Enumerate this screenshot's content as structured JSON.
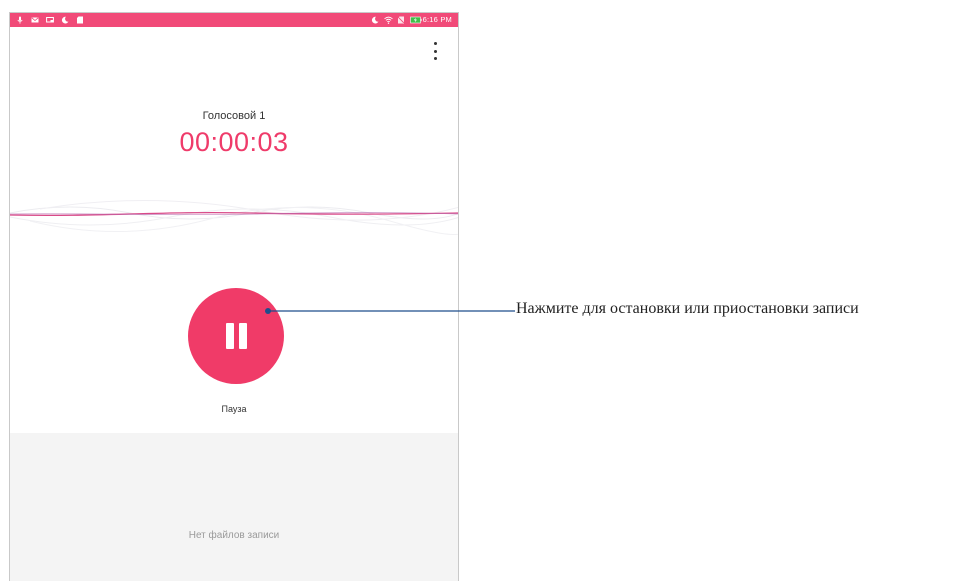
{
  "status_bar": {
    "time": "6:16 PM",
    "color": "#f14a78",
    "left_icons": [
      "mic-icon",
      "mail-icon",
      "screen-icon",
      "moon-icon",
      "sd-card-icon"
    ],
    "right_icons": [
      "moon-icon",
      "wifi-icon",
      "no-sim-icon",
      "battery-charging-icon"
    ]
  },
  "recorder": {
    "title": "Голосовой 1",
    "timer": "00:00:03",
    "accent_color": "#ef3b6a",
    "pause_label": "Пауза",
    "empty_list_text": "Нет файлов записи"
  },
  "callout": {
    "text": "Нажмите для остановки или приостановки записи",
    "line_color": "#1f4e8c"
  }
}
